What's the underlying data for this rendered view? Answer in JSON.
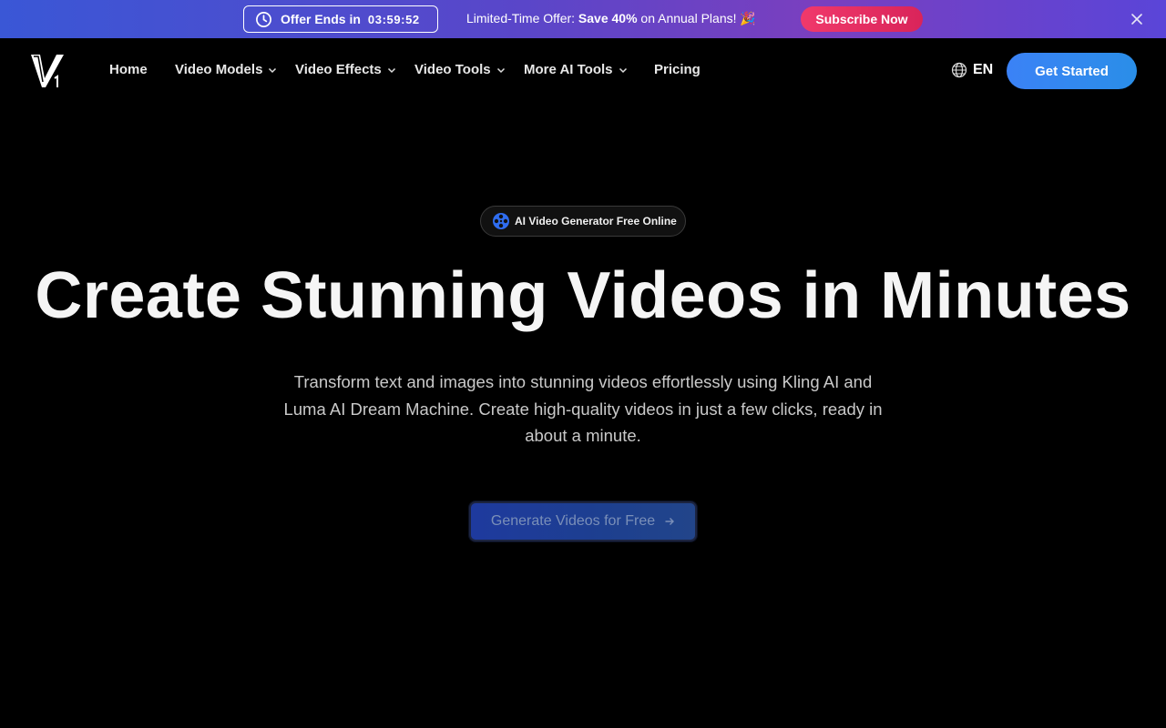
{
  "promo": {
    "timer_label": "Offer Ends in",
    "timer_value": "03:59:52",
    "offer_prefix": "Limited-Time Offer: ",
    "offer_highlight": "Save 40%",
    "offer_suffix": " on Annual Plans! 🎉",
    "subscribe_label": "Subscribe Now"
  },
  "nav": {
    "items": [
      {
        "label": "Home",
        "has_dropdown": false
      },
      {
        "label": "Video Models",
        "has_dropdown": true
      },
      {
        "label": "Video Effects",
        "has_dropdown": true
      },
      {
        "label": "Video Tools",
        "has_dropdown": true
      },
      {
        "label": "More AI Tools",
        "has_dropdown": true
      },
      {
        "label": "Pricing",
        "has_dropdown": false
      }
    ],
    "language": "EN",
    "get_started_label": "Get Started"
  },
  "hero": {
    "badge": "AI Video Generator Free Online",
    "title": "Create Stunning Videos in Minutes",
    "subtitle": "Transform text and images into stunning videos effortlessly using Kling AI and Luma AI Dream Machine. Create high-quality videos in just a few clicks, ready in about a minute.",
    "cta_label": "Generate Videos for Free"
  },
  "colors": {
    "accent": "#3b82f6",
    "subscribe": "#e8315f",
    "background": "#000000"
  },
  "icons": [
    "clock-icon",
    "close-icon",
    "logo-icon",
    "chevron-down-icon",
    "globe-icon",
    "film-reel-icon",
    "arrow-right-icon"
  ]
}
